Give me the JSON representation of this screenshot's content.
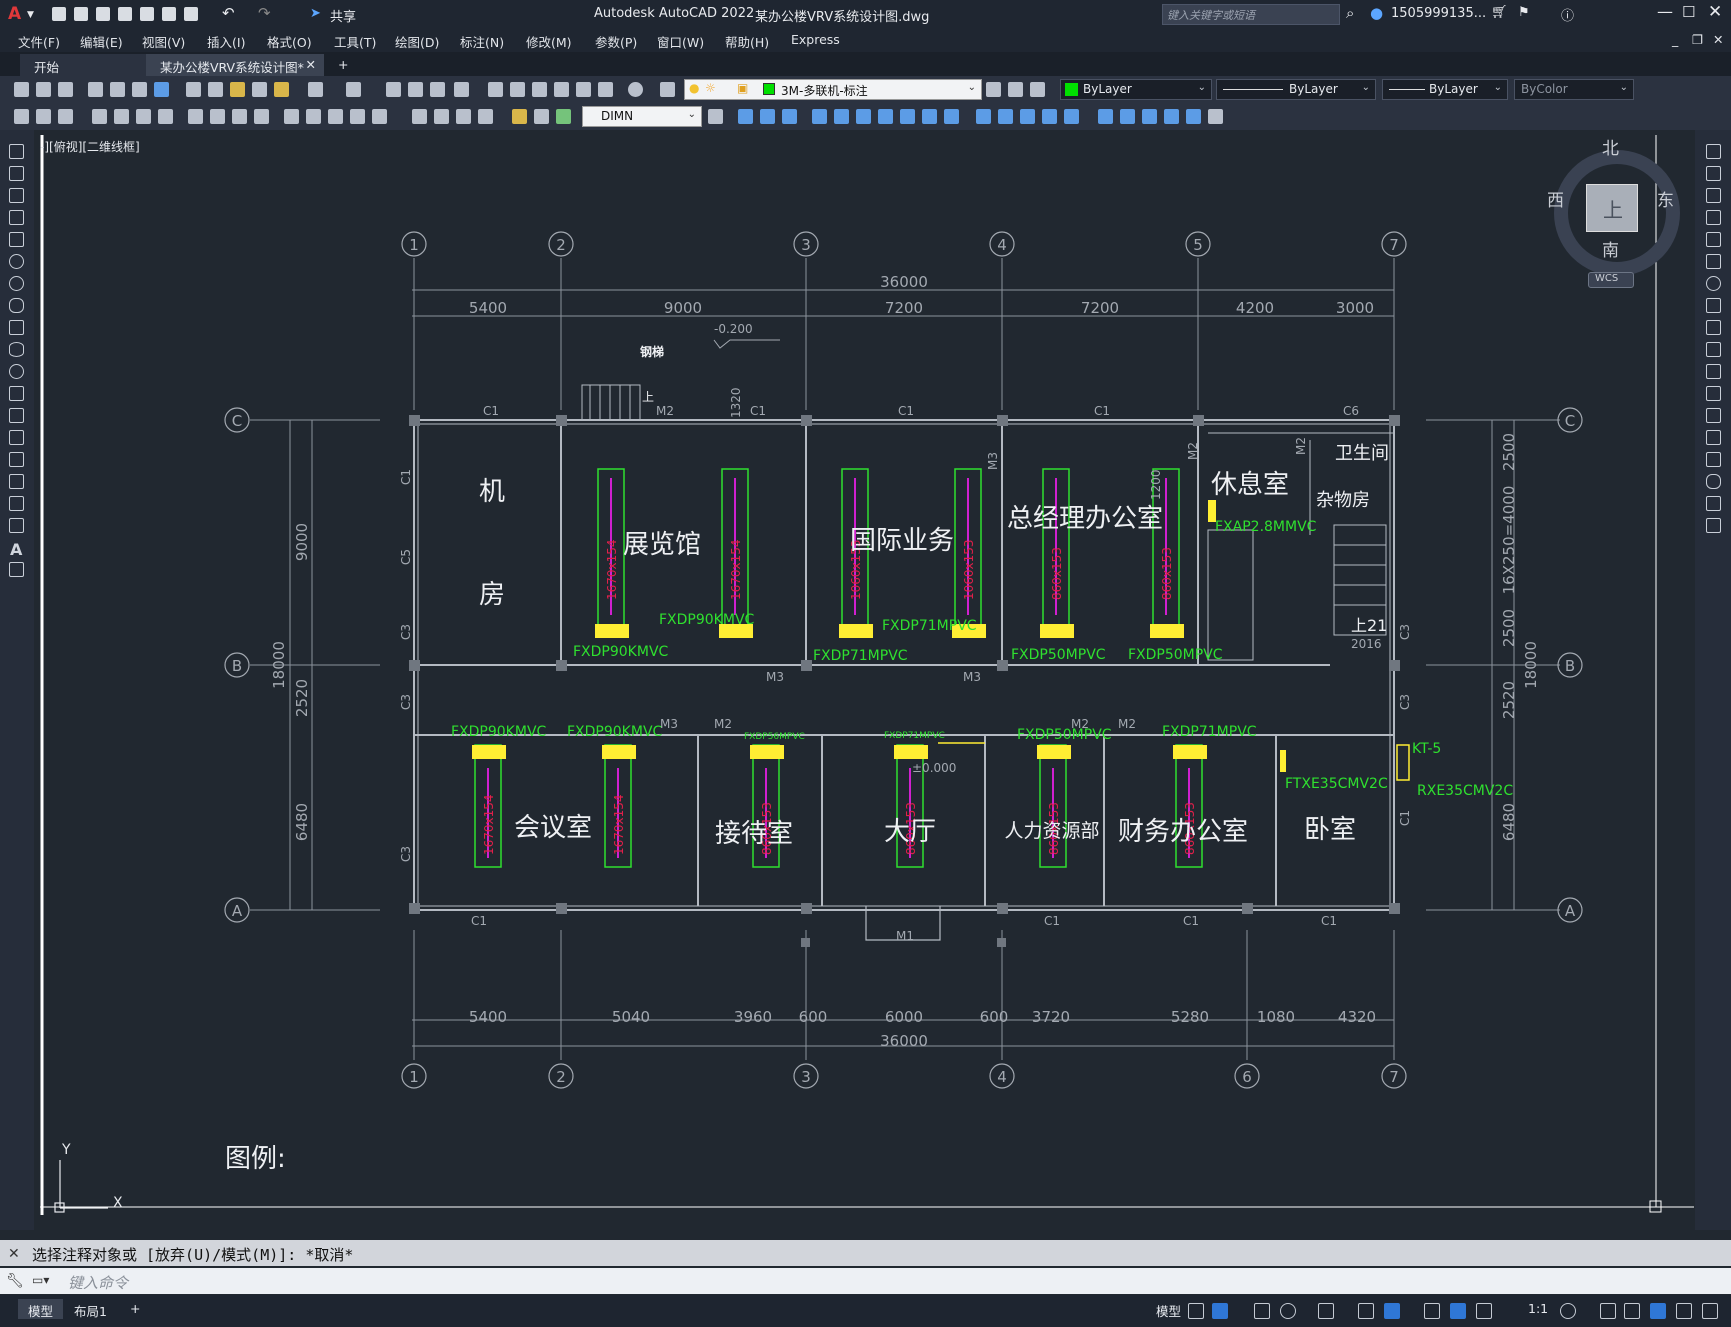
{
  "app": {
    "title": "Autodesk AutoCAD 2022",
    "document": "某办公楼VRV系统设计图.dwg",
    "share_label": "共享",
    "search_placeholder": "键入关键字或短语",
    "user": "1505999135...",
    "logo": "A"
  },
  "menu": [
    "文件(F)",
    "编辑(E)",
    "视图(V)",
    "插入(I)",
    "格式(O)",
    "工具(T)",
    "绘图(D)",
    "标注(N)",
    "修改(M)",
    "参数(P)",
    "窗口(W)",
    "帮助(H)",
    "Express"
  ],
  "tabs": [
    {
      "label": "开始",
      "active": false
    },
    {
      "label": "某办公楼VRV系统设计图*",
      "active": true
    }
  ],
  "toolbar": {
    "layer": "3M-多联机-标注",
    "color": "ByLayer",
    "linetype": "ByLayer",
    "lineweight": "ByLayer",
    "plotstyle": "ByColor",
    "dimstyle": "DIMN"
  },
  "viewport_label": "-][俯视][二维线框]",
  "viewcube": {
    "north": "北",
    "south": "南",
    "east": "东",
    "west": "西",
    "top": "上",
    "wcs": "WCS"
  },
  "drawing": {
    "grid_top": [
      "1",
      "2",
      "3",
      "4",
      "5",
      "7"
    ],
    "grid_bottom": [
      "1",
      "2",
      "3",
      "4",
      "6",
      "7"
    ],
    "grid_rows": [
      "C",
      "B",
      "A"
    ],
    "dims_top": [
      "5400",
      "9000",
      "7200",
      "7200",
      "4200",
      "3000"
    ],
    "dims_bottom": [
      "5400",
      "5040",
      "3960",
      "600",
      "6000",
      "600",
      "3720",
      "5280",
      "1080",
      "4320"
    ],
    "total": "36000",
    "dims_left": [
      "9000",
      "2520",
      "6480",
      "18000"
    ],
    "dims_right": [
      "2500",
      "16X250=4000",
      "2500",
      "2520",
      "6480",
      "18000"
    ],
    "rooms": [
      "机",
      "房",
      "展览馆",
      "国际业务",
      "总经理办公室",
      "休息室",
      "卫生间",
      "杂物房",
      "会议室",
      "接待室",
      "大厅",
      "人力资源部",
      "财务办公室",
      "卧室"
    ],
    "units": [
      "FXDP90KMVC",
      "FXDP90KMVC",
      "FXDP71MPVC",
      "FXDP71MPVC",
      "FXDP50MPVC",
      "FXDP50MPVC",
      "FXDP90KMVC",
      "FXDP90KMVC",
      "FXDP56MPVC",
      "FXDP71MPVC",
      "FXDP50MPVC",
      "FXDP71MPVC",
      "FXAP2.8MMVC",
      "FTXE35CMV2C",
      "RXE35CMV2C",
      "KT-5"
    ],
    "misc": [
      "C1",
      "C3",
      "C5",
      "C6",
      "M1",
      "M2",
      "M3",
      "-0.200",
      "±0.000",
      "钢梯",
      "上",
      "上21",
      "2016",
      "1320",
      "1200"
    ],
    "legend": "图例:"
  },
  "command_history": "选择注释对象或 [放弃(U)/模式(M)]: *取消*",
  "command_placeholder": "键入命令",
  "layout_tabs": [
    "模型",
    "布局1"
  ],
  "status": {
    "model": "模型",
    "scale": "1:1"
  }
}
